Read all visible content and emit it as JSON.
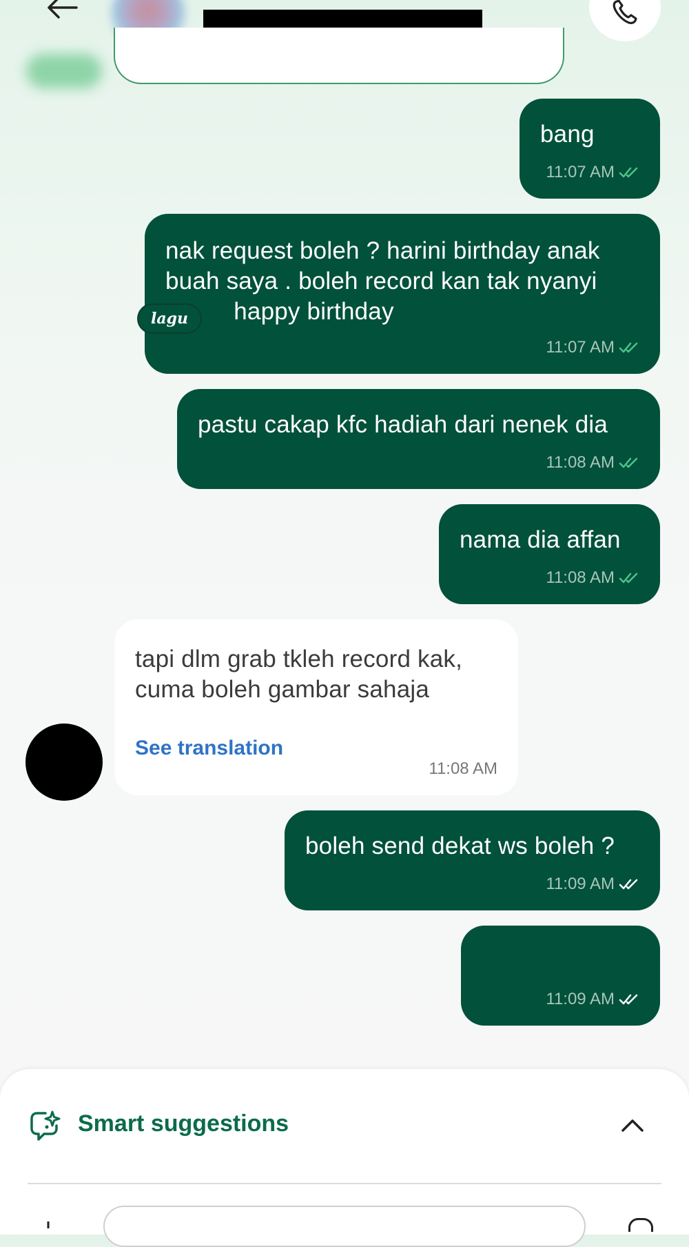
{
  "header": {
    "back_icon": "arrow-left-icon",
    "call_icon": "phone-icon"
  },
  "messages": [
    {
      "direction": "out",
      "text": "bang",
      "time": "11:07 AM",
      "status": "read"
    },
    {
      "direction": "out",
      "text": "nak request boleh ? harini birthday anak\nbuah saya . boleh record kan tak nyanyi\n          happy birthday",
      "time": "11:07 AM",
      "status": "read"
    },
    {
      "direction": "out",
      "text": "pastu cakap kfc hadiah dari nenek dia",
      "time": "11:08 AM",
      "status": "read"
    },
    {
      "direction": "out",
      "text": "nama dia affan",
      "time": "11:08 AM",
      "status": "read"
    },
    {
      "direction": "in",
      "text": "tapi dlm grab tkleh record kak,\ncuma boleh gambar sahaja",
      "translate_label": "See translation",
      "time": "11:08 AM"
    },
    {
      "direction": "out",
      "text": "boleh send dekat ws boleh ?",
      "time": "11:09 AM",
      "status": "delivered"
    },
    {
      "direction": "out",
      "text": "",
      "time": "11:09 AM",
      "status": "delivered"
    }
  ],
  "sticker": {
    "text": "lagu"
  },
  "bottom_sheet": {
    "suggestions_label": "Smart suggestions",
    "suggestions_icon": "sparkle-chat-icon",
    "toggle_icon": "chevron-up-icon"
  },
  "colors": {
    "outgoing_bubble": "#02513a",
    "incoming_bubble": "#ffffff",
    "read_tick": "#4cc38a",
    "delivered_tick": "#ffffff",
    "link": "#2f74c4",
    "accent": "#0b6b4a"
  }
}
